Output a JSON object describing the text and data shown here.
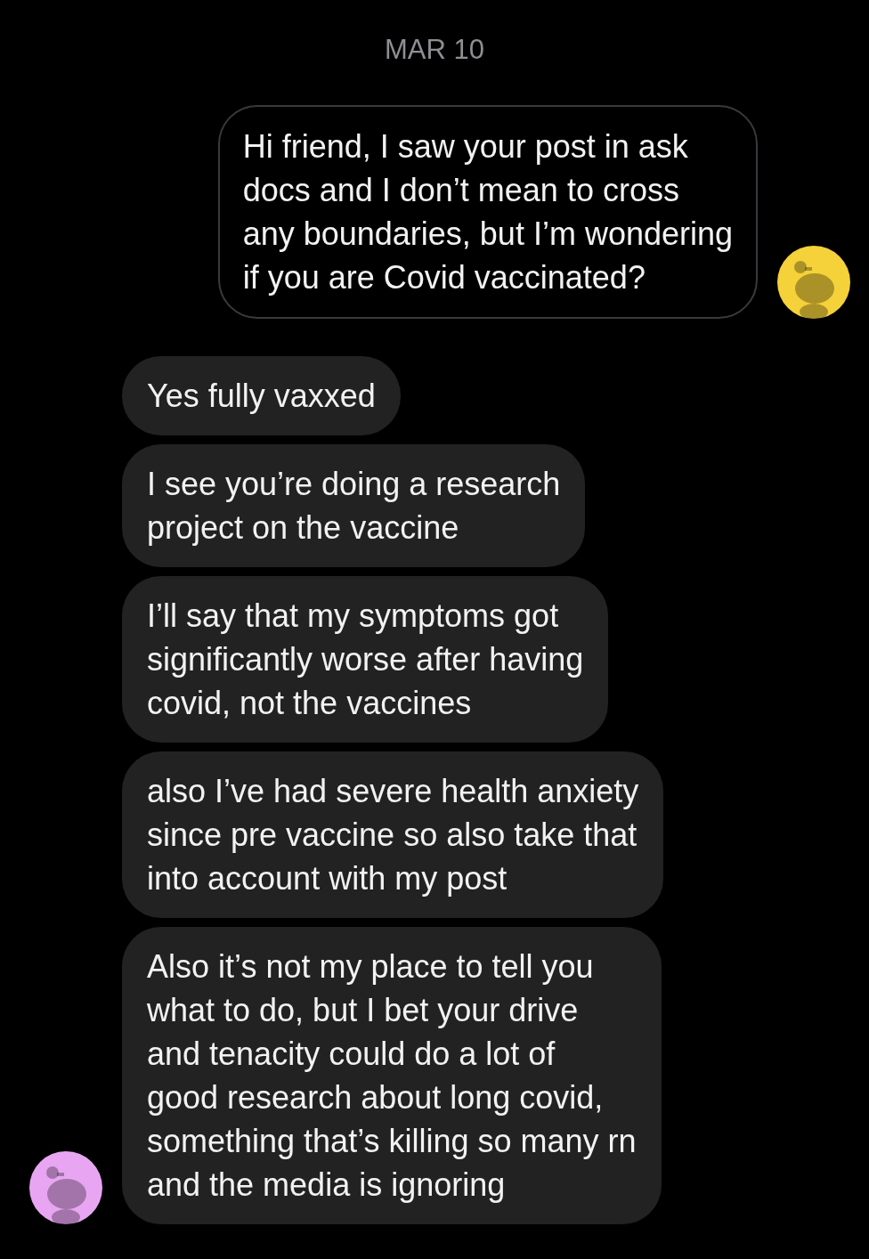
{
  "date": "MAR 10",
  "groups": [
    {
      "kind": "outgoing",
      "color": "#f5d13a",
      "messages": [
        "Hi friend, I saw your post in ask\ndocs and I don’t mean to cross\nany boundaries, but I’m wondering\nif you are Covid vaccinated?"
      ]
    },
    {
      "kind": "incoming",
      "color": "#e8a6f2",
      "messages": [
        "Yes fully vaxxed",
        "I see you’re doing a research\nproject on the vaccine",
        "I’ll say that my symptoms got\nsignificantly worse after having\ncovid, not the vaccines",
        "also I’ve had severe health anxiety\nsince pre vaccine so also take that\ninto account with my post",
        "Also it’s not my place to tell you\nwhat to do, but I bet your drive\nand tenacity could do a lot of\ngood research about long covid,\nsomething that’s killing so many rn\nand the media is ignoring"
      ]
    }
  ]
}
